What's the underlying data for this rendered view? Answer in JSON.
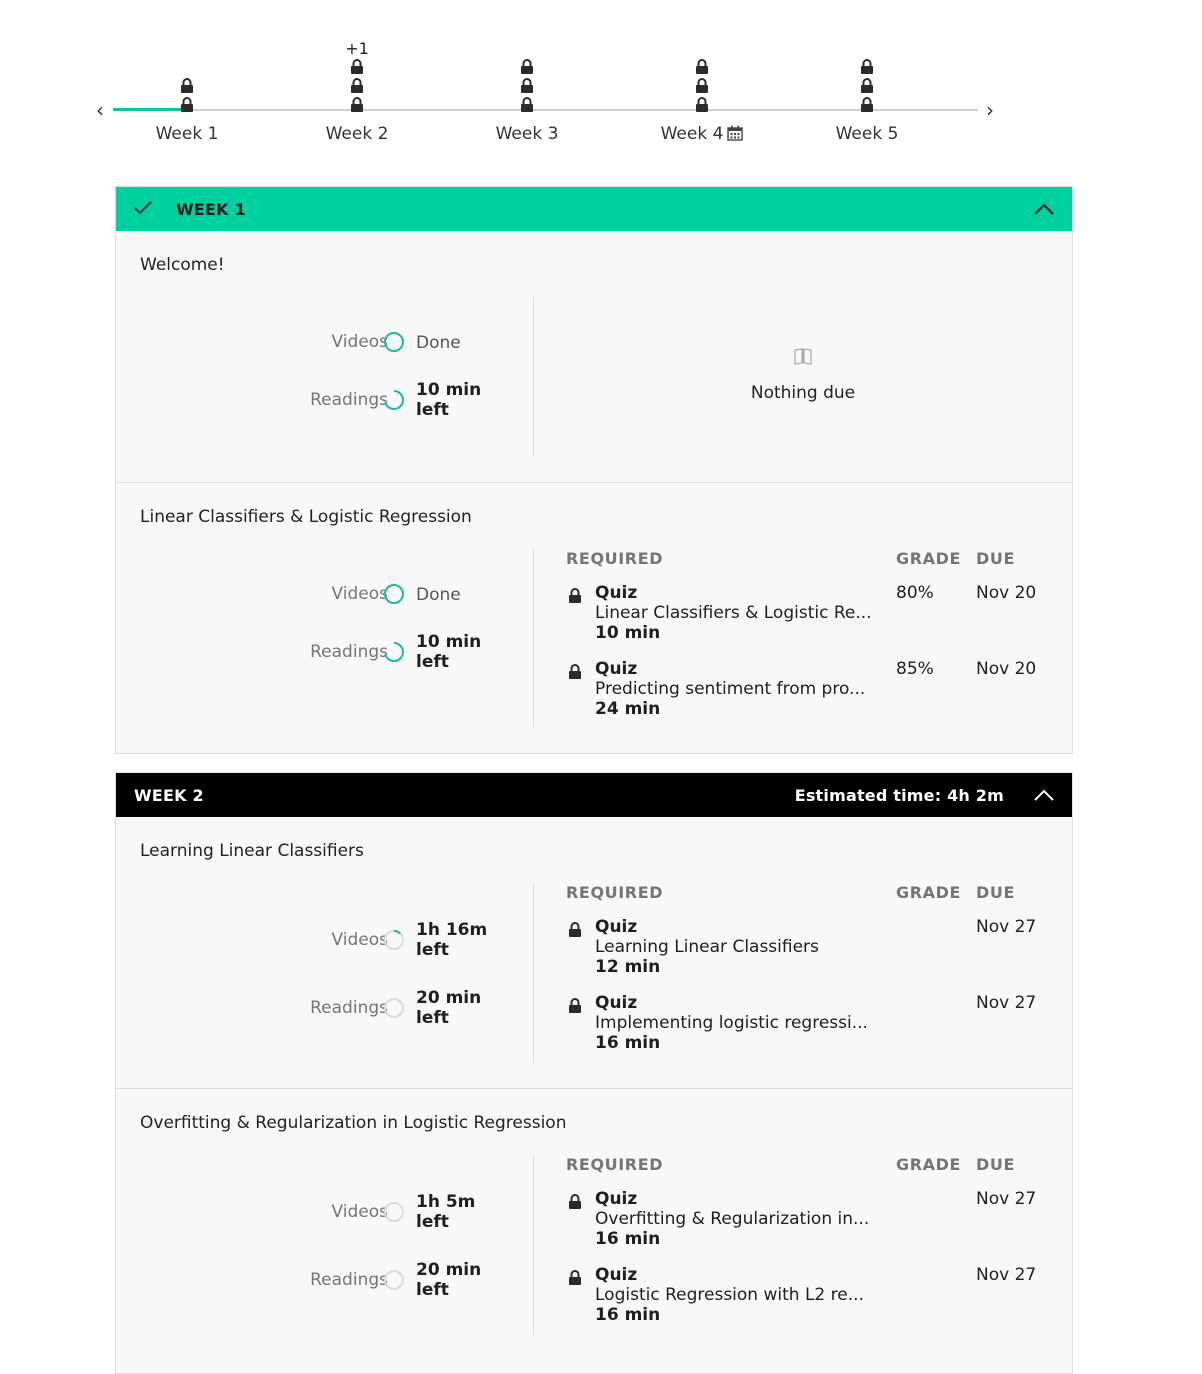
{
  "timeline": {
    "weeks": [
      {
        "label": "Week 1",
        "locks": 2,
        "extra": "",
        "calendar": false
      },
      {
        "label": "Week 2",
        "locks": 3,
        "extra": "+1",
        "calendar": false
      },
      {
        "label": "Week 3",
        "locks": 3,
        "extra": "",
        "calendar": false
      },
      {
        "label": "Week 4",
        "locks": 3,
        "extra": "",
        "calendar": true
      },
      {
        "label": "Week 5",
        "locks": 3,
        "extra": "",
        "calendar": false
      }
    ],
    "prev_arrow": "‹",
    "next_arrow": "›"
  },
  "weeks": [
    {
      "title": "WEEK 1",
      "completed": true,
      "estimated": "",
      "modules": [
        {
          "title": "Welcome!",
          "progress": [
            {
              "label": "Videos",
              "status": "Done",
              "state": "done"
            },
            {
              "label": "Readings",
              "status": "10 min left",
              "state": "partial"
            }
          ],
          "nothing_due": "Nothing due",
          "headers": null,
          "items": []
        },
        {
          "title": "Linear Classifiers & Logistic Regression",
          "progress": [
            {
              "label": "Videos",
              "status": "Done",
              "state": "done"
            },
            {
              "label": "Readings",
              "status": "10 min left",
              "state": "partial"
            }
          ],
          "nothing_due": "",
          "headers": {
            "required": "REQUIRED",
            "grade": "GRADE",
            "due": "DUE"
          },
          "items": [
            {
              "type": "Quiz",
              "name": "Linear Classifiers & Logistic Re...",
              "duration": "10 min",
              "grade": "80%",
              "due": "Nov 20"
            },
            {
              "type": "Quiz",
              "name": "Predicting sentiment from pro...",
              "duration": "24 min",
              "grade": "85%",
              "due": "Nov 20"
            }
          ]
        }
      ]
    },
    {
      "title": "WEEK 2",
      "completed": false,
      "estimated": "Estimated time: 4h 2m",
      "modules": [
        {
          "title": "Learning Linear Classifiers",
          "progress": [
            {
              "label": "Videos",
              "status": "1h 16m left",
              "state": "started"
            },
            {
              "label": "Readings",
              "status": "20 min left",
              "state": "none"
            }
          ],
          "nothing_due": "",
          "headers": {
            "required": "REQUIRED",
            "grade": "GRADE",
            "due": "DUE"
          },
          "items": [
            {
              "type": "Quiz",
              "name": "Learning Linear Classifiers",
              "duration": "12 min",
              "grade": "",
              "due": "Nov 27"
            },
            {
              "type": "Quiz",
              "name": "Implementing logistic regressi...",
              "duration": "16 min",
              "grade": "",
              "due": "Nov 27"
            }
          ]
        },
        {
          "title": "Overfitting & Regularization in Logistic Regression",
          "progress": [
            {
              "label": "Videos",
              "status": "1h 5m left",
              "state": "none"
            },
            {
              "label": "Readings",
              "status": "20 min left",
              "state": "none"
            }
          ],
          "nothing_due": "",
          "headers": {
            "required": "REQUIRED",
            "grade": "GRADE",
            "due": "DUE"
          },
          "items": [
            {
              "type": "Quiz",
              "name": "Overfitting & Regularization in...",
              "duration": "16 min",
              "grade": "",
              "due": "Nov 27"
            },
            {
              "type": "Quiz",
              "name": "Logistic Regression with L2 re...",
              "duration": "16 min",
              "grade": "",
              "due": "Nov 27"
            }
          ]
        }
      ]
    }
  ],
  "colors": {
    "accent": "#1abc9c",
    "week_done_header": "#00cf9f",
    "week_active_header": "#000000"
  }
}
